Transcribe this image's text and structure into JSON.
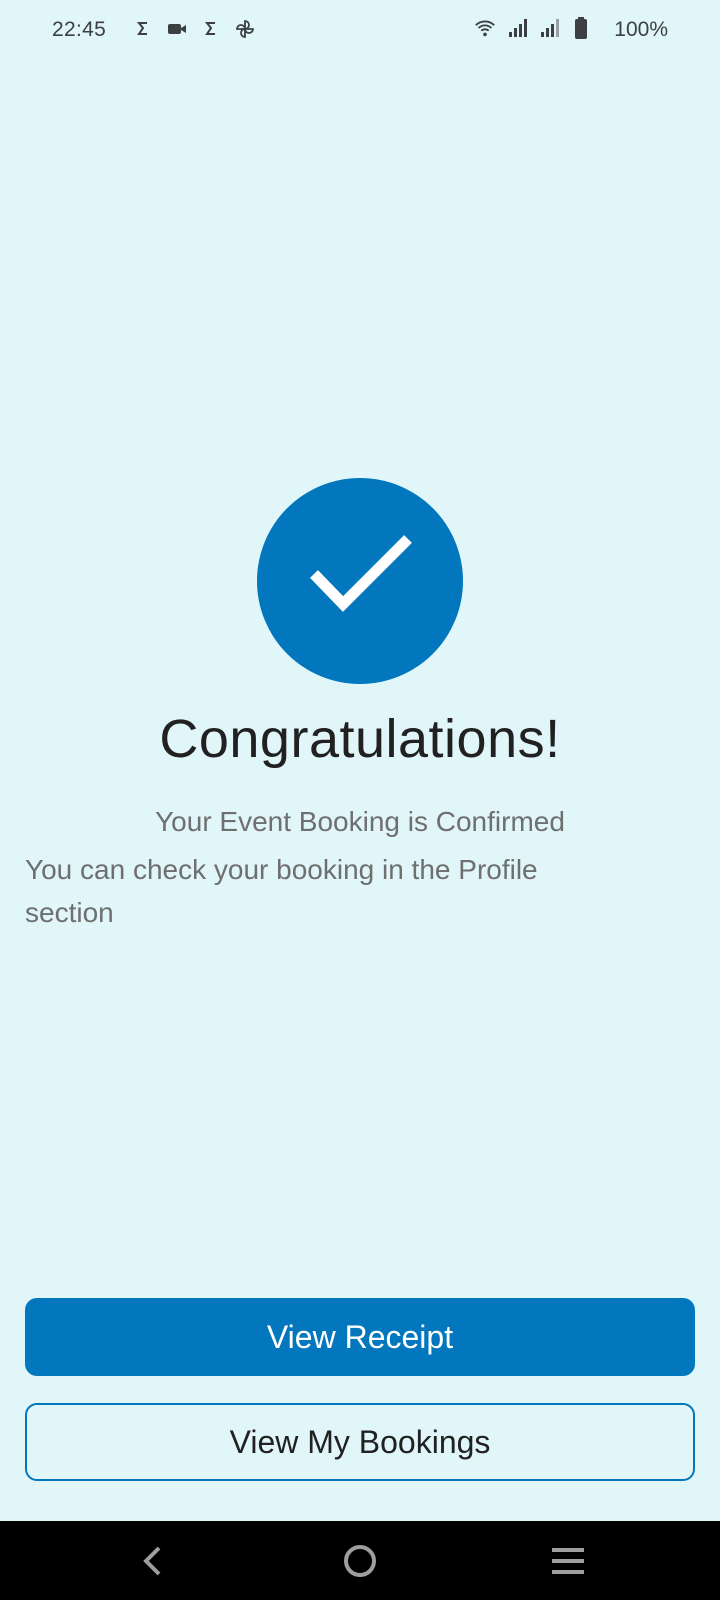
{
  "status_bar": {
    "time": "22:45",
    "battery_percent": "100%",
    "left_icons": [
      "s-logo-icon",
      "video-camera-icon",
      "s-logo-icon",
      "pinwheel-icon"
    ],
    "right_icons": [
      "wifi-icon",
      "signal-icon",
      "signal-icon",
      "battery-icon"
    ]
  },
  "success": {
    "icon": "check-circle-icon",
    "title": "Congratulations!",
    "subtitle": "Your Event Booking is Confirmed",
    "message": "You can check your booking in the Profile section"
  },
  "actions": {
    "primary_label": "View Receipt",
    "secondary_label": "View My Bookings"
  },
  "nav_bar": {
    "icons": [
      "back-icon",
      "home-icon",
      "recent-apps-icon"
    ]
  },
  "colors": {
    "background": "#e0f6f8",
    "accent": "#0277bd",
    "text_primary": "#212121",
    "text_secondary": "#6f6f6f"
  }
}
